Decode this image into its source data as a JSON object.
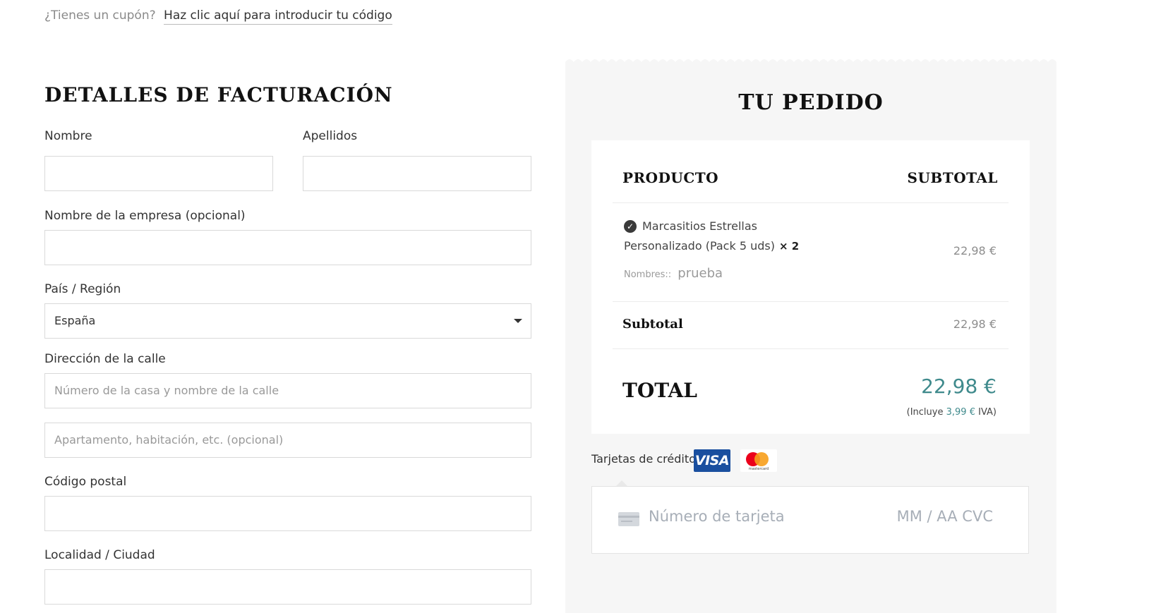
{
  "coupon": {
    "prompt": "¿Tienes un cupón?",
    "link": "Haz clic aquí para introducir tu código"
  },
  "billing": {
    "title": "DETALLES DE FACTURACIÓN",
    "first_name_label": "Nombre",
    "last_name_label": "Apellidos",
    "company_label": "Nombre de la empresa (opcional)",
    "country_label": "País / Región",
    "country_value": "España",
    "street_label": "Dirección de la calle",
    "street_placeholder": "Número de la casa y nombre de la calle",
    "apartment_placeholder": "Apartamento, habitación, etc. (opcional)",
    "postcode_label": "Código postal",
    "city_label": "Localidad / Ciudad"
  },
  "order": {
    "title": "TU PEDIDO",
    "product_header": "PRODUCTO",
    "subtotal_header": "SUBTOTAL",
    "items": [
      {
        "name_line1": "Marcasitios Estrellas",
        "name_line2": "Personalizado (Pack 5 uds)",
        "quantity": "× 2",
        "meta_label": "Nombres::",
        "meta_value": "prueba",
        "price": "22,98 €"
      }
    ],
    "subtotal_label": "Subtotal",
    "subtotal_value": "22,98 €",
    "total_label": "TOTAL",
    "total_value": "22,98 €",
    "tax_prefix": "(Incluye",
    "tax_amount": "3,99 €",
    "tax_suffix": "IVA)"
  },
  "payment": {
    "method_label": "Tarjetas de crédito",
    "visa": "VISA",
    "mastercard": "mastercard",
    "card_number_placeholder": "Número de tarjeta",
    "expiry_cvc_placeholder": "MM / AA  CVC"
  },
  "colors": {
    "accent": "#3f8a8c",
    "panel_bg": "#f6f6f6",
    "visa_blue": "#1a4f9f"
  }
}
